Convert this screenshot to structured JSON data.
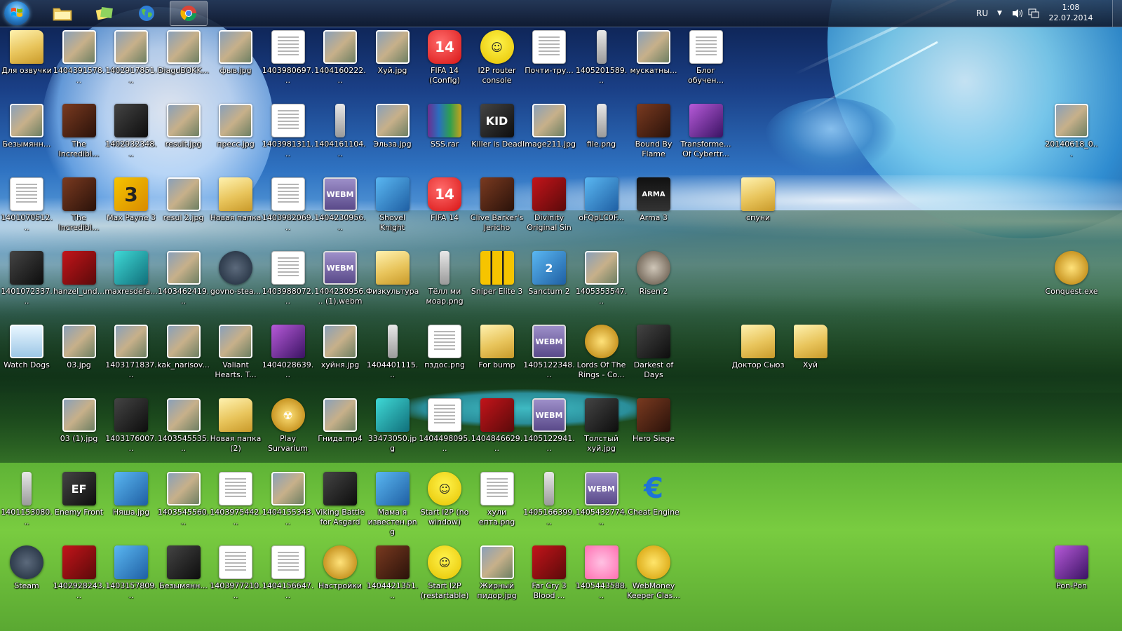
{
  "taskbar": {
    "pinned": [
      {
        "name": "explorer-button",
        "icon": "folder-icon",
        "active": false
      },
      {
        "name": "sticky-notes-button",
        "icon": "sticky-notes-icon",
        "active": false
      },
      {
        "name": "browser-button",
        "icon": "globe-icon",
        "active": false
      },
      {
        "name": "chrome-button",
        "icon": "chrome-icon",
        "active": true
      }
    ],
    "language": "RU",
    "time": "1:08",
    "date": "22.07.2014"
  },
  "icons": [
    {
      "col": 0,
      "row": 0,
      "label": "Для озвучки",
      "type": "folder"
    },
    {
      "col": 1,
      "row": 0,
      "label": "1404391578...",
      "type": "image"
    },
    {
      "col": 2,
      "row": 0,
      "label": "1402917851...",
      "type": "image"
    },
    {
      "col": 3,
      "row": 0,
      "label": "DiaguBOKK...",
      "type": "image"
    },
    {
      "col": 4,
      "row": 0,
      "label": "фыв.jpg",
      "type": "image"
    },
    {
      "col": 5,
      "row": 0,
      "label": "1403980697...",
      "type": "doc"
    },
    {
      "col": 6,
      "row": 0,
      "label": "1404160222...",
      "type": "image"
    },
    {
      "col": 7,
      "row": 0,
      "label": "Хуй.jpg",
      "type": "image"
    },
    {
      "col": 8,
      "row": 0,
      "label": "FIFA 14 (Config)",
      "type": "fifa",
      "glyph": "14"
    },
    {
      "col": 9,
      "row": 0,
      "label": "I2P router console",
      "type": "i2p",
      "glyph": "☺"
    },
    {
      "col": 10,
      "row": 0,
      "label": "Почти-тру...",
      "type": "doc"
    },
    {
      "col": 11,
      "row": 0,
      "label": "1405201589...",
      "type": "slim"
    },
    {
      "col": 12,
      "row": 0,
      "label": "мускатны...",
      "type": "image"
    },
    {
      "col": 13,
      "row": 0,
      "label": "Блог обучен...",
      "type": "doc"
    },
    {
      "col": 0,
      "row": 1,
      "label": "Безымянн...",
      "type": "image"
    },
    {
      "col": 1,
      "row": 1,
      "label": "The Incredibl...",
      "type": "game"
    },
    {
      "col": 2,
      "row": 1,
      "label": "1402932348...",
      "type": "dark"
    },
    {
      "col": 3,
      "row": 1,
      "label": "result.jpg",
      "type": "image"
    },
    {
      "col": 4,
      "row": 1,
      "label": "пресс.jpg",
      "type": "image"
    },
    {
      "col": 5,
      "row": 1,
      "label": "1403981311...",
      "type": "doc"
    },
    {
      "col": 6,
      "row": 1,
      "label": "1404161104...",
      "type": "slim"
    },
    {
      "col": 7,
      "row": 1,
      "label": "Эльза.jpg",
      "type": "image"
    },
    {
      "col": 8,
      "row": 1,
      "label": "SSS.rar",
      "type": "rar"
    },
    {
      "col": 9,
      "row": 1,
      "label": "Killer is Dead",
      "type": "dark",
      "glyph": "KID"
    },
    {
      "col": 10,
      "row": 1,
      "label": "Image211.jpg",
      "type": "image"
    },
    {
      "col": 11,
      "row": 1,
      "label": "file.png",
      "type": "slim"
    },
    {
      "col": 12,
      "row": 1,
      "label": "Bound By Flame",
      "type": "game"
    },
    {
      "col": 13,
      "row": 1,
      "label": "Transforme... Of Cybertr...",
      "type": "purple"
    },
    {
      "col": 20,
      "row": 1,
      "label": "20140618_0...",
      "type": "image"
    },
    {
      "col": 0,
      "row": 2,
      "label": "1401070512...",
      "type": "doc"
    },
    {
      "col": 1,
      "row": 2,
      "label": "The Incredibl...",
      "type": "game"
    },
    {
      "col": 2,
      "row": 2,
      "label": "Max Payne 3",
      "type": "mp3",
      "glyph": "3"
    },
    {
      "col": 3,
      "row": 2,
      "label": "resul 2.jpg",
      "type": "image"
    },
    {
      "col": 4,
      "row": 2,
      "label": "Новая папка",
      "type": "folder"
    },
    {
      "col": 5,
      "row": 2,
      "label": "1403982069...",
      "type": "doc"
    },
    {
      "col": 6,
      "row": 2,
      "label": "1404230956...",
      "type": "webm",
      "glyph": "WEBM"
    },
    {
      "col": 7,
      "row": 2,
      "label": "Shovel Knight",
      "type": "blue"
    },
    {
      "col": 8,
      "row": 2,
      "label": "FIFA 14",
      "type": "fifa",
      "glyph": "14"
    },
    {
      "col": 9,
      "row": 2,
      "label": "Clive Barker's Jericho",
      "type": "game"
    },
    {
      "col": 10,
      "row": 2,
      "label": "Divinity Original Sin",
      "type": "red"
    },
    {
      "col": 11,
      "row": 2,
      "label": "oFQpLC0F...",
      "type": "blue"
    },
    {
      "col": 12,
      "row": 2,
      "label": "Arma 3",
      "type": "arma",
      "glyph": "ARMA"
    },
    {
      "col": 14,
      "row": 2,
      "label": "спуни",
      "type": "folder"
    },
    {
      "col": 0,
      "row": 3,
      "label": "1401072337...",
      "type": "dark"
    },
    {
      "col": 1,
      "row": 3,
      "label": "hanzel_und...",
      "type": "red"
    },
    {
      "col": 2,
      "row": 3,
      "label": "maxresdefa...",
      "type": "teal"
    },
    {
      "col": 3,
      "row": 3,
      "label": "1403462419...",
      "type": "image"
    },
    {
      "col": 4,
      "row": 3,
      "label": "govno-stea...",
      "type": "steam"
    },
    {
      "col": 5,
      "row": 3,
      "label": "1403988072...",
      "type": "doc"
    },
    {
      "col": 6,
      "row": 3,
      "label": "1404230956... (1).webm",
      "type": "webm",
      "glyph": "WEBM"
    },
    {
      "col": 7,
      "row": 3,
      "label": "Физкультура",
      "type": "folder"
    },
    {
      "col": 8,
      "row": 3,
      "label": "Тёлл ми моар.png",
      "type": "slim"
    },
    {
      "col": 9,
      "row": 3,
      "label": "Sniper Elite 3",
      "type": "sniper"
    },
    {
      "col": 10,
      "row": 3,
      "label": "Sanctum 2",
      "type": "blue",
      "glyph": "2"
    },
    {
      "col": 11,
      "row": 3,
      "label": "1405353547...",
      "type": "image"
    },
    {
      "col": 12,
      "row": 3,
      "label": "Risen 2",
      "type": "skull"
    },
    {
      "col": 20,
      "row": 3,
      "label": "Conquest.exe",
      "type": "gold"
    },
    {
      "col": 0,
      "row": 4,
      "label": "Watch Dogs",
      "type": "watch"
    },
    {
      "col": 1,
      "row": 4,
      "label": "03.jpg",
      "type": "image"
    },
    {
      "col": 2,
      "row": 4,
      "label": "1403171837...",
      "type": "image"
    },
    {
      "col": 3,
      "row": 4,
      "label": "kak_narisov...",
      "type": "image"
    },
    {
      "col": 4,
      "row": 4,
      "label": "Valiant Hearts. T...",
      "type": "image"
    },
    {
      "col": 5,
      "row": 4,
      "label": "1404028639...",
      "type": "purple"
    },
    {
      "col": 6,
      "row": 4,
      "label": "хуйня.jpg",
      "type": "image"
    },
    {
      "col": 7,
      "row": 4,
      "label": "1404401115...",
      "type": "slim"
    },
    {
      "col": 8,
      "row": 4,
      "label": "пздос.png",
      "type": "doc"
    },
    {
      "col": 9,
      "row": 4,
      "label": "For bump",
      "type": "folder"
    },
    {
      "col": 10,
      "row": 4,
      "label": "1405122348...",
      "type": "webm",
      "glyph": "WEBM"
    },
    {
      "col": 11,
      "row": 4,
      "label": "Lords Of The Rings - Co...",
      "type": "gold"
    },
    {
      "col": 12,
      "row": 4,
      "label": "Darkest of Days",
      "type": "dark"
    },
    {
      "col": 14,
      "row": 4,
      "label": "Доктор Сьюз",
      "type": "folder"
    },
    {
      "col": 15,
      "row": 4,
      "label": "Хуй",
      "type": "folder"
    },
    {
      "col": 1,
      "row": 5,
      "label": "03 (1).jpg",
      "type": "image"
    },
    {
      "col": 2,
      "row": 5,
      "label": "1403176007...",
      "type": "dark"
    },
    {
      "col": 3,
      "row": 5,
      "label": "1403545535...",
      "type": "image"
    },
    {
      "col": 4,
      "row": 5,
      "label": "Новая папка (2)",
      "type": "folder"
    },
    {
      "col": 5,
      "row": 5,
      "label": "Play Survarium",
      "type": "gold",
      "glyph": "☢"
    },
    {
      "col": 6,
      "row": 5,
      "label": "Гнида.mp4",
      "type": "image"
    },
    {
      "col": 7,
      "row": 5,
      "label": "33473050.jpg",
      "type": "teal"
    },
    {
      "col": 8,
      "row": 5,
      "label": "1404498095...",
      "type": "doc"
    },
    {
      "col": 9,
      "row": 5,
      "label": "1404846629...",
      "type": "red"
    },
    {
      "col": 10,
      "row": 5,
      "label": "1405122941...",
      "type": "webm",
      "glyph": "WEBM"
    },
    {
      "col": 11,
      "row": 5,
      "label": "Толстый хуй.jpg",
      "type": "dark"
    },
    {
      "col": 12,
      "row": 5,
      "label": "Hero Siege",
      "type": "game"
    },
    {
      "col": 0,
      "row": 6,
      "label": "1401153080...",
      "type": "slim"
    },
    {
      "col": 1,
      "row": 6,
      "label": "Enemy Front",
      "type": "dark",
      "glyph": "EF"
    },
    {
      "col": 2,
      "row": 6,
      "label": "Няша.jpg",
      "type": "blue"
    },
    {
      "col": 3,
      "row": 6,
      "label": "1403545560...",
      "type": "image"
    },
    {
      "col": 4,
      "row": 6,
      "label": "1403975442...",
      "type": "doc"
    },
    {
      "col": 5,
      "row": 6,
      "label": "1404155343...",
      "type": "image"
    },
    {
      "col": 6,
      "row": 6,
      "label": "Viking Battle for Asgard",
      "type": "dark"
    },
    {
      "col": 7,
      "row": 6,
      "label": "Мама я известен.png",
      "type": "blue"
    },
    {
      "col": 8,
      "row": 6,
      "label": "Start I2P (no window)",
      "type": "i2p",
      "glyph": "☺"
    },
    {
      "col": 9,
      "row": 6,
      "label": "хули епта.png",
      "type": "doc"
    },
    {
      "col": 10,
      "row": 6,
      "label": "1405166399...",
      "type": "slim"
    },
    {
      "col": 11,
      "row": 6,
      "label": "1405432774...",
      "type": "webm",
      "glyph": "WEBM"
    },
    {
      "col": 12,
      "row": 6,
      "label": "Cheat Engine",
      "type": "cheat",
      "glyph": "€"
    },
    {
      "col": 0,
      "row": 7,
      "label": "Steam",
      "type": "steam"
    },
    {
      "col": 1,
      "row": 7,
      "label": "1402928243...",
      "type": "red"
    },
    {
      "col": 2,
      "row": 7,
      "label": "1403157809...",
      "type": "blue"
    },
    {
      "col": 3,
      "row": 7,
      "label": "Безымянн...",
      "type": "dark"
    },
    {
      "col": 4,
      "row": 7,
      "label": "1403977210...",
      "type": "doc"
    },
    {
      "col": 5,
      "row": 7,
      "label": "1404156647...",
      "type": "doc"
    },
    {
      "col": 6,
      "row": 7,
      "label": "Настройки",
      "type": "gold"
    },
    {
      "col": 7,
      "row": 7,
      "label": "1404421351...",
      "type": "game"
    },
    {
      "col": 8,
      "row": 7,
      "label": "Start I2P (restartable)",
      "type": "i2p",
      "glyph": "☺"
    },
    {
      "col": 9,
      "row": 7,
      "label": "Жирный пидор.jpg",
      "type": "image"
    },
    {
      "col": 10,
      "row": 7,
      "label": "Far Cry 3 Blood ...",
      "type": "red"
    },
    {
      "col": 11,
      "row": 7,
      "label": "1405443588...",
      "type": "pink"
    },
    {
      "col": 12,
      "row": 7,
      "label": "WebMoney Keeper Clas...",
      "type": "webmoney"
    },
    {
      "col": 20,
      "row": 7,
      "label": "Pon-Pon",
      "type": "purple"
    }
  ]
}
